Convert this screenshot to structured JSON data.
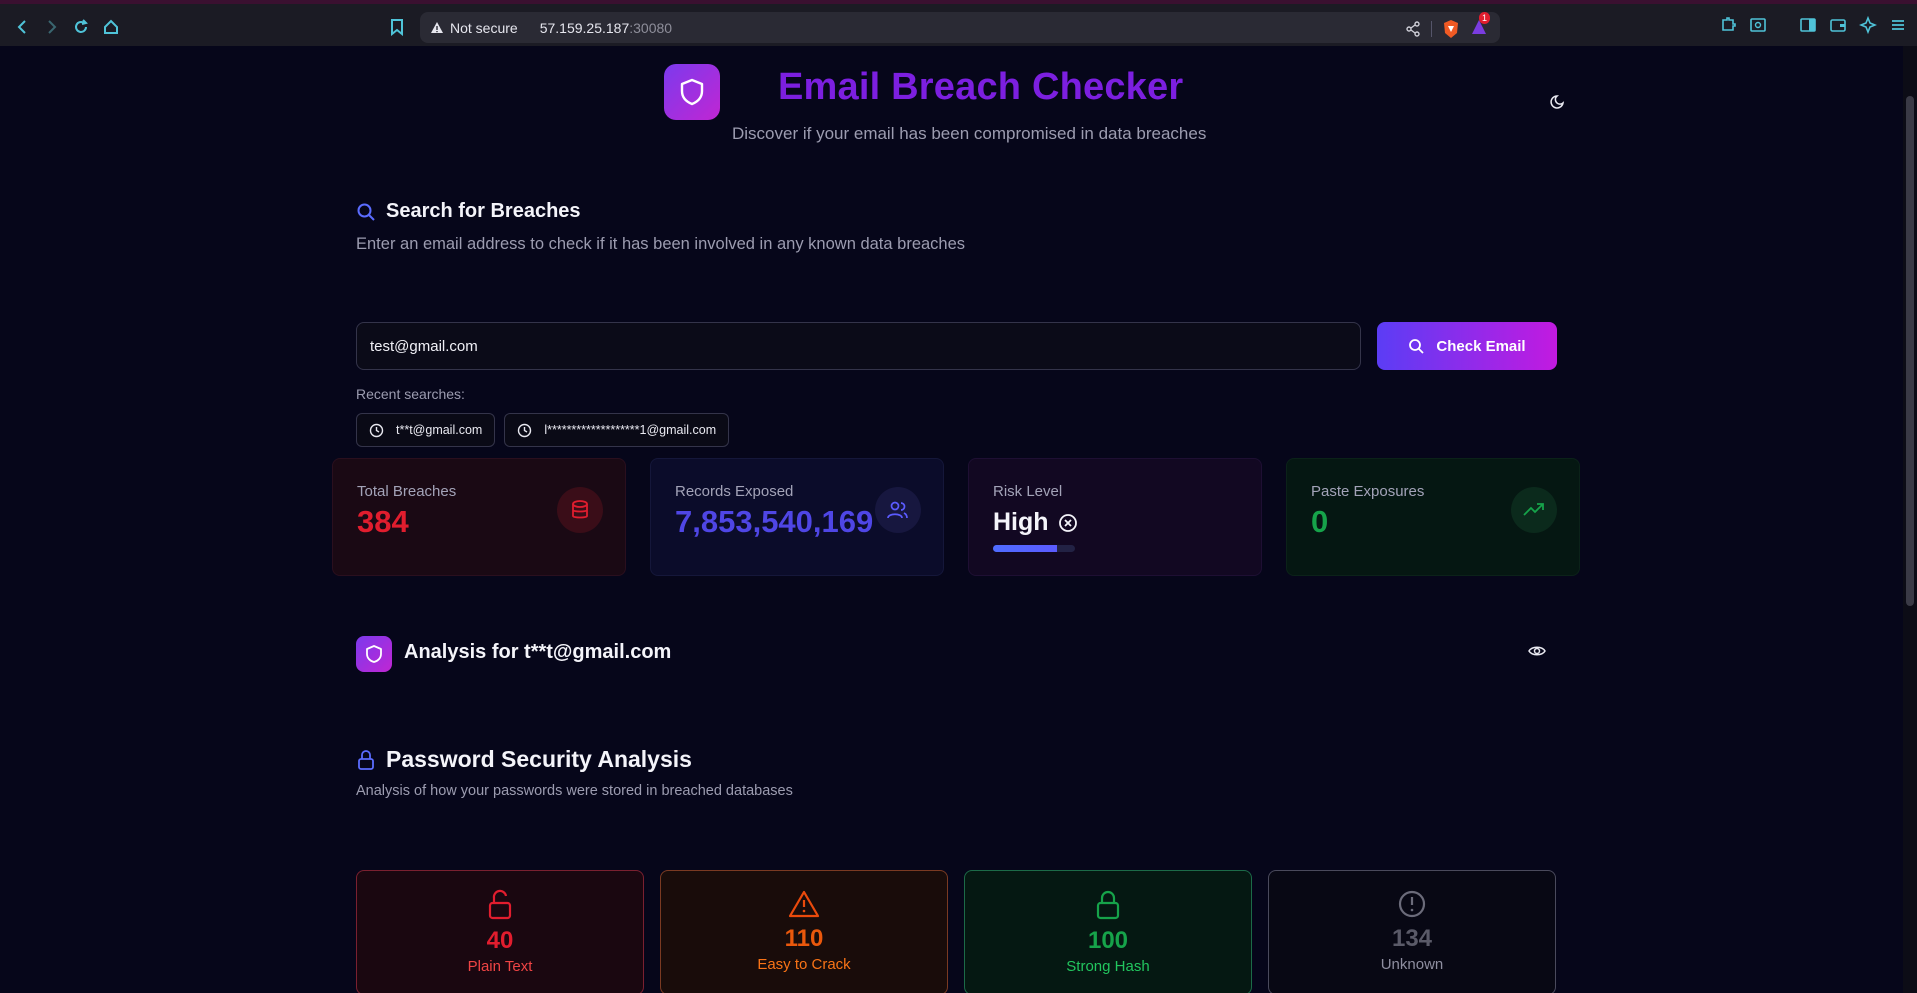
{
  "browser": {
    "security_label": "Not secure",
    "url_host": "57.159.25.187",
    "url_port": ":30080",
    "notification_badge": "1"
  },
  "header": {
    "title": "Email Breach Checker",
    "subtitle": "Discover if your email has been compromised in data breaches"
  },
  "search": {
    "title": "Search for Breaches",
    "description": "Enter an email address to check if it has been involved in any known data breaches",
    "input_value": "test@gmail.com",
    "button_label": "Check Email",
    "recent_label": "Recent searches:",
    "recent": [
      "t**t@gmail.com",
      "l*******************1@gmail.com"
    ]
  },
  "stats": {
    "total_breaches_label": "Total Breaches",
    "total_breaches_value": "384",
    "records_label": "Records Exposed",
    "records_value": "7,853,540,169",
    "risk_label": "Risk Level",
    "risk_value": "High",
    "risk_fill_percent": 78,
    "paste_label": "Paste Exposures",
    "paste_value": "0"
  },
  "analysis": {
    "title": "Analysis for t**t@gmail.com"
  },
  "password": {
    "title": "Password Security Analysis",
    "description": "Analysis of how your passwords were stored in breached databases",
    "cards": [
      {
        "value": "40",
        "label": "Plain Text"
      },
      {
        "value": "110",
        "label": "Easy to Crack"
      },
      {
        "value": "100",
        "label": "Strong Hash"
      },
      {
        "value": "134",
        "label": "Unknown"
      }
    ]
  },
  "colors": {
    "accent_purple": "#7c1fe0",
    "danger_red": "#e11d2e",
    "orange": "#ea580c",
    "green": "#16a34a",
    "indigo": "#4f46e5"
  }
}
